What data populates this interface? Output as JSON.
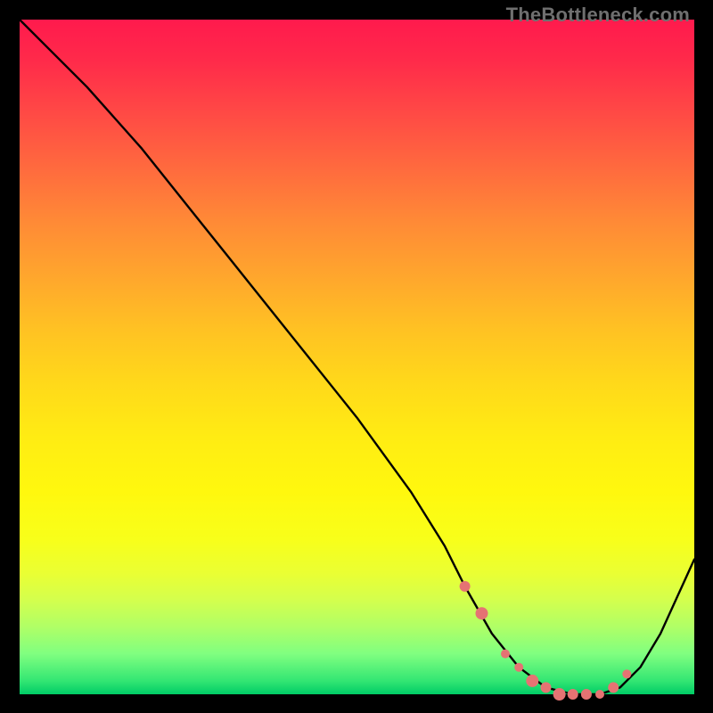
{
  "watermark": "TheBottleneck.com",
  "chart_data": {
    "type": "line",
    "title": "",
    "xlabel": "",
    "ylabel": "",
    "xlim": [
      0,
      100
    ],
    "ylim": [
      0,
      100
    ],
    "series": [
      {
        "name": "bottleneck-curve",
        "x": [
          0,
          4,
          10,
          18,
          26,
          34,
          42,
          50,
          58,
          63,
          66,
          70,
          74,
          78,
          82,
          86,
          89,
          92,
          95,
          100
        ],
        "y": [
          100,
          96,
          90,
          81,
          71,
          61,
          51,
          41,
          30,
          22,
          16,
          9,
          4,
          1,
          0,
          0,
          1,
          4,
          9,
          20
        ]
      }
    ],
    "markers": {
      "name": "highlight-dots",
      "x": [
        66,
        68.5,
        72,
        74,
        76,
        78,
        80,
        82,
        84,
        86,
        88,
        90
      ],
      "y": [
        16,
        12,
        6,
        4,
        2,
        1,
        0,
        0,
        0,
        0,
        1,
        3
      ],
      "r": [
        6,
        7,
        5,
        5,
        7,
        6,
        7,
        6,
        6,
        5,
        6,
        5
      ]
    },
    "colors": {
      "curve": "#000000",
      "marker": "#e57373",
      "gradient_top": "#ff1a4d",
      "gradient_bottom": "#00cc66"
    }
  }
}
